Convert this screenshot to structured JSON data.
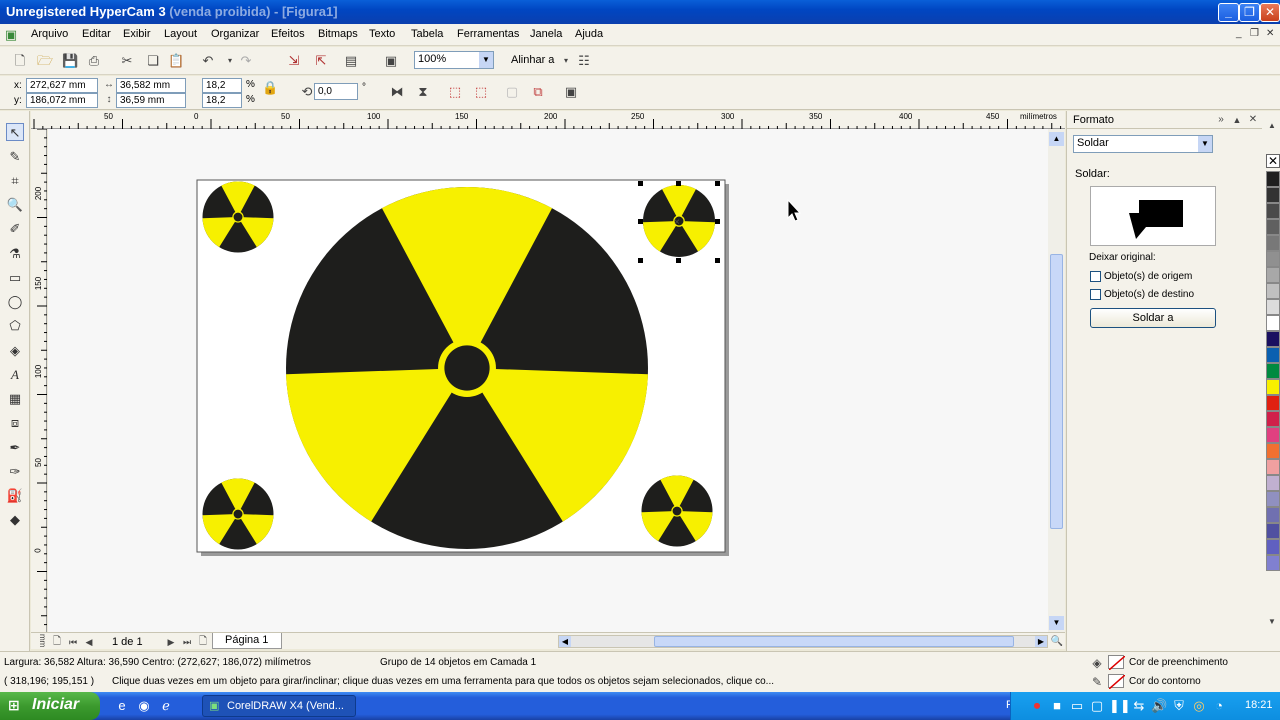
{
  "window": {
    "title": "Unregistered HyperCam 3",
    "subtitle": "(venda proibida) - [Figura1]"
  },
  "menu": [
    "Arquivo",
    "Editar",
    "Exibir",
    "Layout",
    "Organizar",
    "Efeitos",
    "Bitmaps",
    "Texto",
    "Tabela",
    "Ferramentas",
    "Janela",
    "Ajuda"
  ],
  "toolbar": {
    "zoom": "100%",
    "align_label": "Alinhar a"
  },
  "propbar": {
    "x_label": "x:",
    "y_label": "y:",
    "x": "272,627 mm",
    "y": "186,072 mm",
    "width": "36,582 mm",
    "height": "36,59 mm",
    "scale_x": "18,2",
    "scale_y": "18,2",
    "percent": "%",
    "rotation": "0,0",
    "degree": "°"
  },
  "ruler": {
    "h_ticks": [
      "50",
      "0",
      "50",
      "100",
      "150",
      "200",
      "250",
      "300",
      "350",
      "400",
      "450"
    ],
    "unit": "milímetros",
    "v_ticks": [
      "200",
      "150",
      "100",
      "50",
      "0"
    ]
  },
  "docker": {
    "title": "Formato",
    "dropdown": "Soldar",
    "section": "Soldar:",
    "keep_label": "Deixar original:",
    "opt1": "Objeto(s) de origem",
    "opt2": "Objeto(s) de destino",
    "button": "Soldar a"
  },
  "pagenav": {
    "pos": "1 de 1",
    "tab": "Página 1"
  },
  "status": {
    "line1": "Largura: 36,582  Altura: 36,590  Centro: (272,627; 186,072)  milímetros",
    "group": "Grupo de 14 objetos em Camada 1",
    "coords": "( 318,196; 195,151 )",
    "hint": "Clique duas vezes em um objeto para girar/inclinar; clique duas vezes em uma ferramenta para que todos os objetos sejam selecionados, clique co...",
    "fill": "Cor de preenchimento",
    "outline": "Cor do contorno"
  },
  "taskbar": {
    "start": "Iniciar",
    "task": "CorelDRAW X4 (Vend...",
    "lang": "PT",
    "clock": "18:21"
  },
  "colors": {
    "yellow": "#f7f000",
    "dark": "#1e1e1c",
    "palette": [
      "#202020",
      "#333333",
      "#4a4a4a",
      "#606060",
      "#787878",
      "#909090",
      "#a8a8a8",
      "#c0c0c0",
      "#dcdcdc",
      "#ffffff",
      "#1a1060",
      "#0a60b0",
      "#008a40",
      "#f8f000",
      "#e02010",
      "#d0204a",
      "#e04080",
      "#f07030",
      "#f0a0a0",
      "#c0b0d0",
      "#9090c0",
      "#7070b0",
      "#5050a0",
      "#6060c0",
      "#8080d0"
    ]
  }
}
